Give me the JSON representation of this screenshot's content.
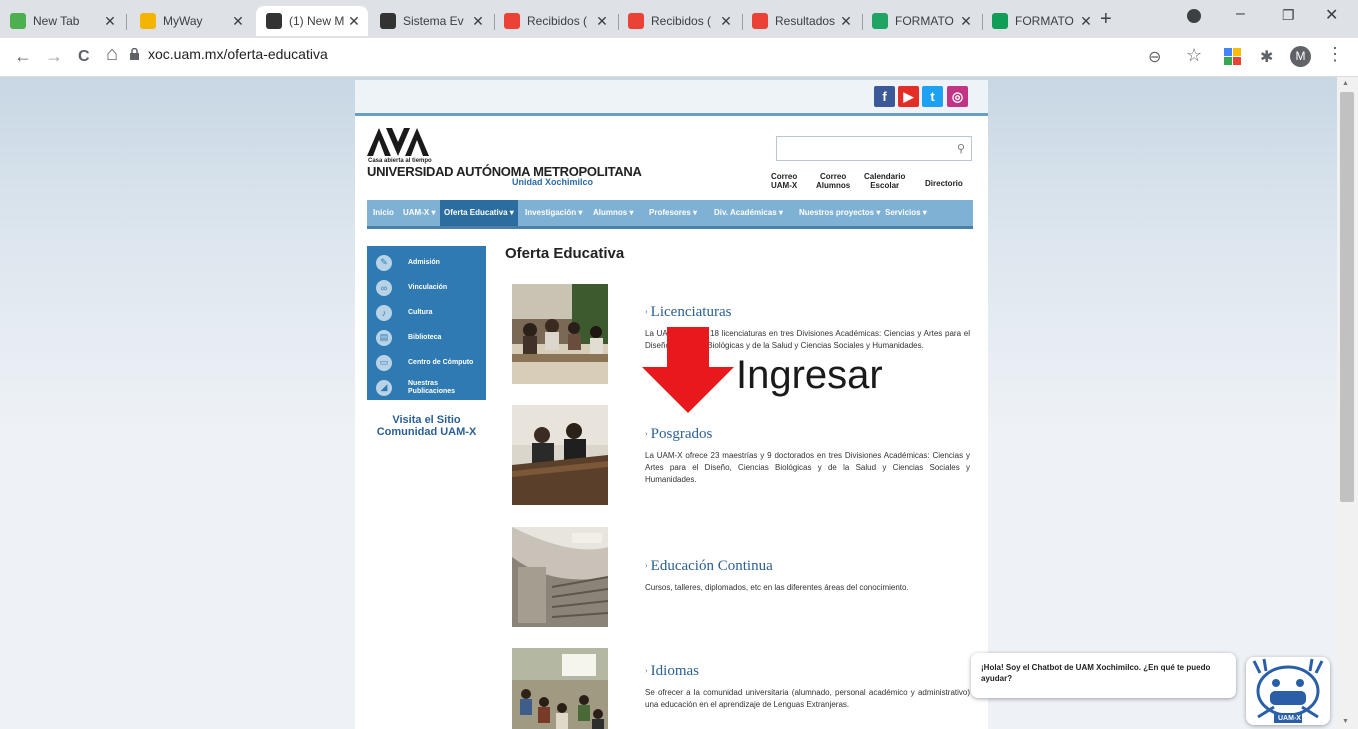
{
  "browser": {
    "tabs": [
      {
        "title": "New Tab",
        "favicon": "newtab-icon",
        "color": "#4caf50"
      },
      {
        "title": "MyWay",
        "favicon": "myway-icon",
        "color": "#f4b400"
      },
      {
        "title": "(1) New M",
        "favicon": "uam-icon",
        "color": "#333333"
      },
      {
        "title": "Sistema Ev",
        "favicon": "cbs-icon",
        "color": "#333333"
      },
      {
        "title": "Recibidos (",
        "favicon": "gmail-icon",
        "color": "#ea4335"
      },
      {
        "title": "Recibidos (",
        "favicon": "gmail-icon",
        "color": "#ea4335"
      },
      {
        "title": "Resultados",
        "favicon": "gmail-icon",
        "color": "#ea4335"
      },
      {
        "title": "FORMATO",
        "favicon": "drive-icon",
        "color": "#1fa463"
      },
      {
        "title": "FORMATO",
        "favicon": "sheets-icon",
        "color": "#0f9d58"
      }
    ],
    "tab_close": "✕",
    "new_tab": "+",
    "url": "xoc.uam.mx/oferta-educativa",
    "profile_initial": "M",
    "nav": {
      "back": "←",
      "forward": "→",
      "reload": "C",
      "home": "⌂"
    },
    "win": {
      "minimize": "–",
      "maximize": "❐",
      "close": "✕"
    },
    "toolbar_icons": {
      "zoom": "⊖",
      "star": "☆",
      "ext_puzzle": "✱",
      "menu": "⋮",
      "tabsearch": "⌄"
    }
  },
  "site": {
    "social": [
      {
        "name": "facebook-icon",
        "glyph": "f",
        "color": "#3b5998"
      },
      {
        "name": "youtube-icon",
        "glyph": "▶",
        "color": "#e52d27"
      },
      {
        "name": "twitter-icon",
        "glyph": "t",
        "color": "#1da1f2"
      },
      {
        "name": "instagram-icon",
        "glyph": "◎",
        "color": "#c13584"
      }
    ],
    "tagline": "Casa abierta al tiempo",
    "university": "UNIVERSIDAD AUTÓNOMA METROPOLITANA",
    "unit": "Unidad Xochimilco",
    "search_icon": "⚲",
    "quick_links": [
      {
        "l1": "Correo",
        "l2": "UAM-X"
      },
      {
        "l1": "Correo",
        "l2": "Alumnos"
      },
      {
        "l1": "Calendario",
        "l2": "Escolar"
      },
      {
        "l1": "Directorio",
        "l2": ""
      }
    ],
    "menu": [
      {
        "label": "Inicio",
        "selected": false
      },
      {
        "label": "UAM-X ▾",
        "selected": false
      },
      {
        "label": "Oferta Educativa ▾",
        "selected": true
      },
      {
        "label": "Investigación ▾",
        "selected": false
      },
      {
        "label": "Alumnos ▾",
        "selected": false
      },
      {
        "label": "Profesores ▾",
        "selected": false
      },
      {
        "label": "Div. Académicas ▾",
        "selected": false
      },
      {
        "label": "Nuestros proyectos ▾",
        "selected": false
      },
      {
        "label": "Servicios ▾",
        "selected": false
      }
    ],
    "sidebar": [
      {
        "label": "Admisión",
        "icon": "pencil-icon",
        "glyph": "✎"
      },
      {
        "label": "Vinculación",
        "icon": "link-icon",
        "glyph": "∞"
      },
      {
        "label": "Cultura",
        "icon": "microphone-icon",
        "glyph": "♪"
      },
      {
        "label": "Biblioteca",
        "icon": "book-icon",
        "glyph": "▤"
      },
      {
        "label": "Centro de Cómputo",
        "icon": "computer-icon",
        "glyph": "▭"
      },
      {
        "label": "Nuestras Publicaciones",
        "icon": "publications-icon",
        "glyph": "◢"
      }
    ],
    "visit": "Visita el Sitio Comunidad UAM-X",
    "heading": "Oferta Educativa",
    "sections": [
      {
        "title": "Licenciaturas",
        "desc": "La UAM-X ofrece 18 licenciaturas en tres Divisiones Académicas: Ciencias y Artes para el Diseño, Ciencias Biológicas y de la Salud y Ciencias Sociales y Humanidades."
      },
      {
        "title": "Posgrados",
        "desc": "La UAM-X ofrece 23 maestrías y 9 doctorados en tres Divisiones Académicas: Ciencias y Artes para el Diseño, Ciencias Biológicas y de la Salud y Ciencias Sociales y Humanidades."
      },
      {
        "title": "Educación Continua",
        "desc": "Cursos, talleres, diplomados, etc en las diferentes áreas del conocimiento."
      },
      {
        "title": "Idiomas",
        "desc": "Se ofrecer a la comunidad universitaria (alumnado, personal académico y administrativo) una educación en el aprendizaje de Lenguas Extranjeras."
      }
    ],
    "section_marker": "›"
  },
  "annotation": {
    "text": "Ingresar",
    "arrow_color": "#e8191c"
  },
  "chatbot": {
    "message": "¡Hola! Soy el Chatbot de UAM Xochimilco. ¿En qué te puedo ayudar?",
    "badge": "UAM-X"
  }
}
